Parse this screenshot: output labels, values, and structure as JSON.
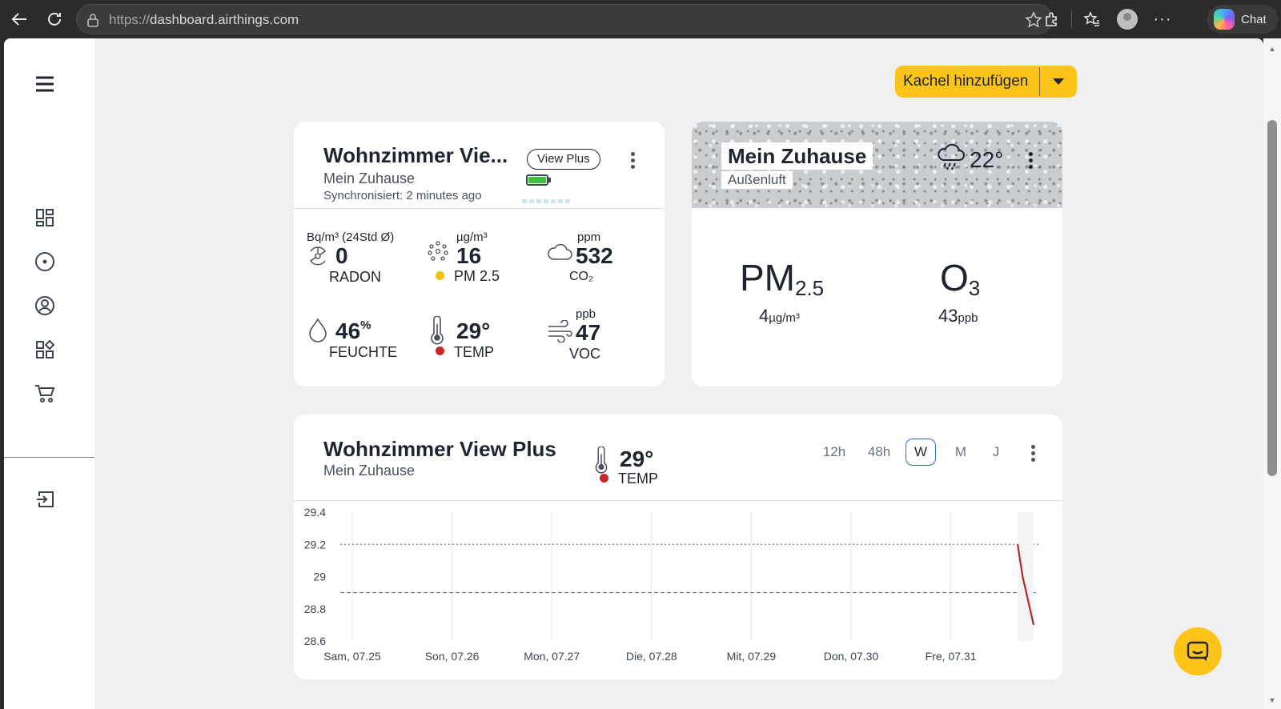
{
  "browser": {
    "url_prefix": "https://",
    "url_domain": "dashboard.airthings.com",
    "chat_label": "Chat"
  },
  "toolbar": {
    "add_tile_label": "Kachel hinzufügen"
  },
  "device_card": {
    "title": "Wohnzimmer Vie...",
    "location": "Mein Zuhause",
    "sync": "Synchronisiert: 2 minutes ago",
    "model_pill": "View Plus",
    "battery_level": 1.0,
    "metrics": {
      "radon": {
        "unit": "Bq/m³ (24Std Ø)",
        "value": "0",
        "name": "RADON"
      },
      "pm25": {
        "unit": "µg/m³",
        "value": "16",
        "name": "PM 2.5",
        "status_color": "#f2c00f"
      },
      "co2": {
        "unit": "ppm",
        "value": "532",
        "name": "CO₂"
      },
      "humidity": {
        "value": "46",
        "suffix": "%",
        "name": "FEUCHTE"
      },
      "temp": {
        "value": "29°",
        "name": "TEMP",
        "status_color": "#c62828"
      },
      "voc": {
        "unit": "ppb",
        "value": "47",
        "name": "VOC"
      }
    }
  },
  "outdoor_card": {
    "title": "Mein Zuhause",
    "subtitle": "Außenluft",
    "temperature": "22°",
    "weather_icon": "rain-cloud-icon",
    "pm_label": "PM",
    "pm_sub": "2.5",
    "pm_value": "4",
    "pm_unit": "µg/m³",
    "o3_label": "O",
    "o3_sub": "3",
    "o3_value": "43",
    "o3_unit": "ppb"
  },
  "chart_card": {
    "title": "Wohnzimmer View Plus",
    "location": "Mein Zuhause",
    "metric_value": "29°",
    "metric_name": "TEMP",
    "metric_color": "#c62828",
    "ranges": [
      "12h",
      "48h",
      "W",
      "M",
      "J"
    ],
    "active_range": "W"
  },
  "chart_data": {
    "type": "line",
    "x": [
      "Sam, 07.25",
      "Son, 07.26",
      "Mon, 07.27",
      "Die, 07.28",
      "Mit, 07.29",
      "Don, 07.30",
      "Fre, 07.31"
    ],
    "y_ticks": [
      29.4,
      29.2,
      29,
      28.8,
      28.6
    ],
    "ylim": [
      28.6,
      29.4
    ],
    "threshold_dotted": 29.2,
    "threshold_dashed": 28.9,
    "series": [
      {
        "color": "#b02a2a",
        "points": [
          [
            6.67,
            29.2
          ],
          [
            6.72,
            29.0
          ],
          [
            6.83,
            28.7
          ]
        ]
      }
    ]
  },
  "colors": {
    "accent": "#fcc419",
    "active_range_border": "#2f6fb2",
    "temp_line": "#b02a2a"
  }
}
